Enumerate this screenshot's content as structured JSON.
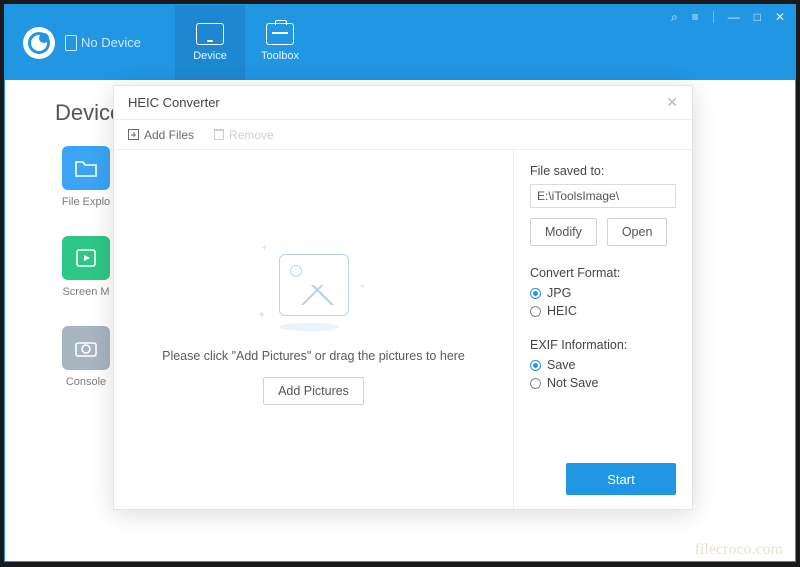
{
  "header": {
    "status": "No Device",
    "nav": {
      "device": "Device",
      "toolbox": "Toolbox"
    }
  },
  "page": {
    "title": "Device",
    "tools": {
      "file_explorer": "File Explo",
      "screen_mirror": "Screen M",
      "console": "Console"
    }
  },
  "modal": {
    "title": "HEIC Converter",
    "toolbar": {
      "add_files": "Add Files",
      "remove": "Remove"
    },
    "drop": {
      "hint": "Please click \"Add Pictures\" or drag the pictures to here",
      "add_btn": "Add Pictures"
    },
    "side": {
      "saved_label": "File saved to:",
      "saved_path": "E:\\iToolsImage\\",
      "modify": "Modify",
      "open": "Open",
      "format_label": "Convert Format:",
      "format": {
        "jpg": "JPG",
        "heic": "HEIC",
        "selected": "jpg"
      },
      "exif_label": "EXIF Information:",
      "exif": {
        "save": "Save",
        "not_save": "Not Save",
        "selected": "save"
      },
      "start": "Start"
    }
  },
  "watermark": "filecroco.com"
}
